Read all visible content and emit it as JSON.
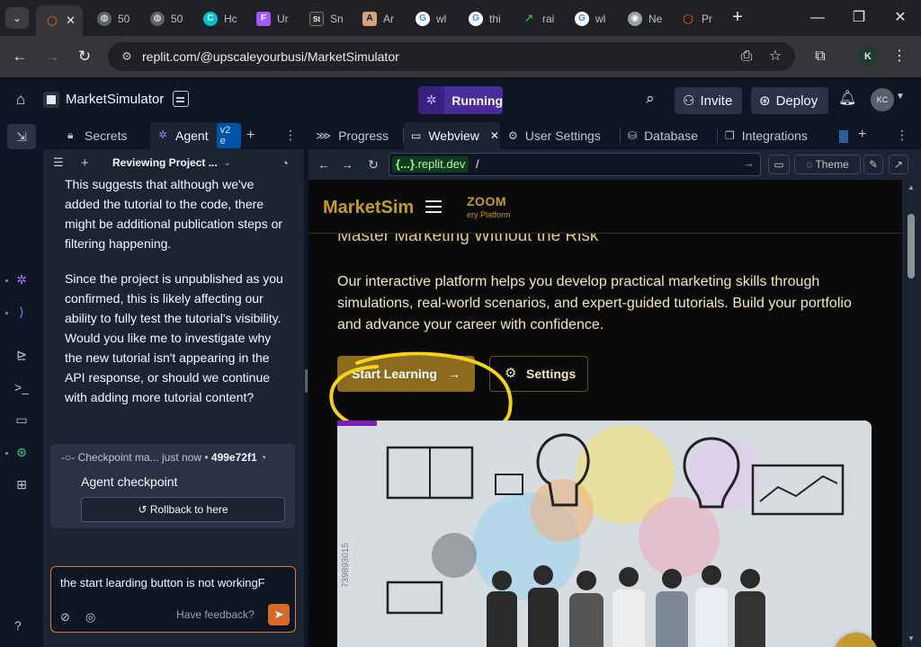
{
  "browser": {
    "tabs": [
      {
        "title": "",
        "icon": "replit-logo",
        "color": "#f26207",
        "active": true
      },
      {
        "title": "50",
        "icon": "globe-icon",
        "color": "#9aa0a6"
      },
      {
        "title": "50",
        "icon": "globe-icon",
        "color": "#9aa0a6"
      },
      {
        "title": "Hc",
        "icon": "canva-logo",
        "color": "#01c3cc"
      },
      {
        "title": "Ur",
        "icon": "figma-logo",
        "color": "#a259ff"
      },
      {
        "title": "Sn",
        "icon": "st-logo",
        "color": "#2b2b2b"
      },
      {
        "title": "Ar",
        "icon": "anthropic-logo",
        "color": "#d4a27f"
      },
      {
        "title": "wl",
        "icon": "google-logo",
        "color": "#4285f4"
      },
      {
        "title": "thi",
        "icon": "google-logo",
        "color": "#4285f4"
      },
      {
        "title": "rai",
        "icon": "chart-logo",
        "color": "#34a853"
      },
      {
        "title": "wl",
        "icon": "google-logo",
        "color": "#4285f4"
      },
      {
        "title": "Ne",
        "icon": "chrome-logo",
        "color": "#9aa0a6"
      },
      {
        "title": "Pr",
        "icon": "replit-logo",
        "color": "#f26207"
      }
    ],
    "url": "replit.com/@upscaleyourbusi/MarketSimulator",
    "profile_initial": "K"
  },
  "replit": {
    "project_name": "MarketSimulator",
    "run_status": "Running",
    "invite_label": "Invite",
    "deploy_label": "Deploy",
    "avatar_initials": "KC"
  },
  "agent_panel": {
    "tabs": [
      {
        "label": "Secrets",
        "icon": "lock-icon"
      },
      {
        "label": "Agent",
        "icon": "agent-icon",
        "badge": "v2 e"
      }
    ],
    "thread_title": "Reviewing Project ...",
    "messages": [
      "This suggests that although we've added the tutorial to the code, there might be additional publication steps or filtering happening.",
      "Since the project is unpublished as you confirmed, this is likely affecting our ability to fully test the tutorial's visibility. Would you like me to investigate why the new tutorial isn't appearing in the API response, or should we continue with adding more tutorial content?"
    ],
    "checkpoint": {
      "label": "Checkpoint ma...",
      "time": "just now",
      "hash": "499e72f1",
      "title": "Agent checkpoint",
      "rollback_label": "Rollback to here"
    },
    "input_value": "the start learding button is not workingF",
    "feedback_label": "Have feedback?"
  },
  "tool_panel": {
    "tabs": [
      {
        "label": "Progress",
        "icon": "progress-icon"
      },
      {
        "label": "Webview",
        "icon": "webview-icon",
        "active": true
      },
      {
        "label": "User Settings",
        "icon": "gear-icon"
      },
      {
        "label": "Database",
        "icon": "database-icon"
      },
      {
        "label": "Integrations",
        "icon": "integrations-icon"
      }
    ],
    "webview_domain_prefix": "{...}",
    "webview_domain": ".replit.dev",
    "webview_path": "/",
    "theme_label": "Theme"
  },
  "site": {
    "brand": "MarketSim",
    "partner_logo": "ZOOM",
    "partner_sub": "ery Platform",
    "hero_title": "Master Marketing Without the Risk",
    "hero_text": "Our interactive platform helps you develop practical marketing skills through simulations, real-world scenarios, and expert-guided tutorials. Build your portfolio and advance your career with confidence.",
    "start_label": "Start Learning",
    "settings_label": "Settings",
    "image_id": "739893015",
    "accent": "#c79a2f"
  }
}
